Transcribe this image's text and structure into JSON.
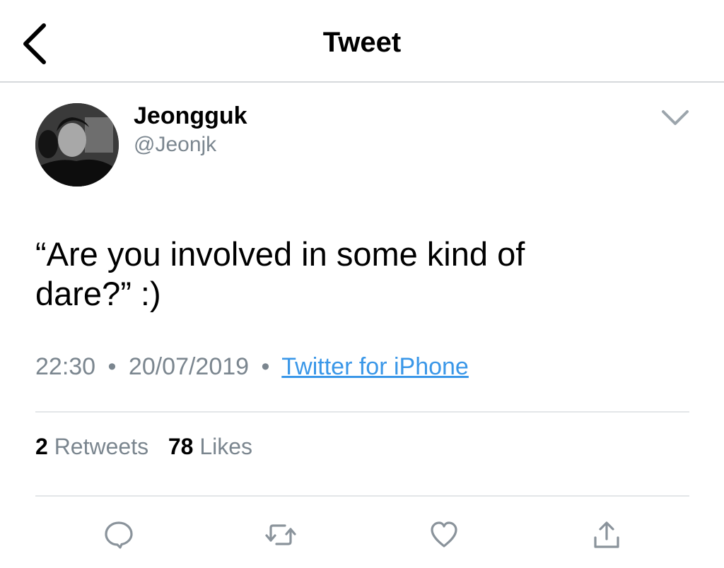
{
  "header": {
    "title": "Tweet"
  },
  "tweet": {
    "display_name": "Jeongguk",
    "handle": "@Jeonjk",
    "text_line1": "“Are you involved in some kind of",
    "text_line2": "dare?” :)",
    "time": "22:30",
    "date": "20/07/2019",
    "separator": "•",
    "source": "Twitter for iPhone"
  },
  "stats": {
    "retweets_count": "2",
    "retweets_label": "Retweets",
    "likes_count": "78",
    "likes_label": "Likes"
  },
  "icons": {
    "back": "chevron-left-icon",
    "more": "chevron-down-icon",
    "reply": "speech-bubble-icon",
    "retweet": "retweet-icon",
    "like": "heart-icon",
    "share": "share-icon"
  },
  "colors": {
    "link": "#3a97e8",
    "muted": "#7b868f",
    "icon": "#8a939b",
    "divider": "#e3e6e8"
  }
}
